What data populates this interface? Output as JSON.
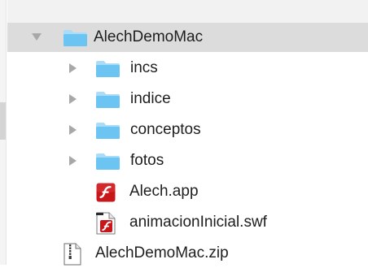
{
  "finder": {
    "tree": {
      "root": {
        "name": "AlechDemoMac",
        "expanded": true,
        "icon": "folder-icon"
      },
      "children": [
        {
          "name": "incs",
          "icon": "folder-icon",
          "expandable": true
        },
        {
          "name": "indice",
          "icon": "folder-icon",
          "expandable": true
        },
        {
          "name": "conceptos",
          "icon": "folder-icon",
          "expandable": true
        },
        {
          "name": "fotos",
          "icon": "folder-icon",
          "expandable": true
        },
        {
          "name": "Alech.app",
          "icon": "flash-app-icon",
          "expandable": false
        },
        {
          "name": "animacionInicial.swf",
          "icon": "swf-document-icon",
          "expandable": false
        }
      ],
      "sibling": {
        "name": "AlechDemoMac.zip",
        "icon": "zip-archive-icon"
      }
    }
  },
  "colors": {
    "selection": "#dcdcdc",
    "folder_body": "#6cc4f3",
    "folder_tab": "#a8dcf8",
    "flash_red": "#c8171b",
    "disclosure": "#a8a8a8"
  }
}
